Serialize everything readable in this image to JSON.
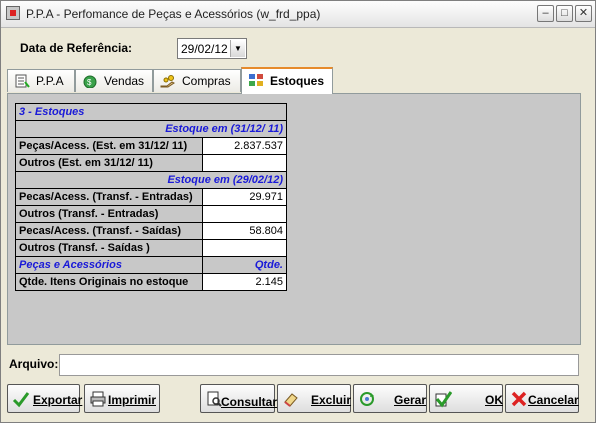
{
  "window": {
    "title": "P.P.A - Perfomance de Peças e Acessórios (w_frd_ppa)"
  },
  "reference": {
    "label": "Data de Referência:",
    "date": "29/02/12"
  },
  "tabs": [
    {
      "label": "P.P.A"
    },
    {
      "label": "Vendas"
    },
    {
      "label": "Compras"
    },
    {
      "label": "Estoques"
    }
  ],
  "stock": {
    "section_title": "3 - Estoques",
    "header1": "Estoque em (31/12/ 11)",
    "rows1": [
      {
        "label": "Peças/Acess. (Est. em 31/12/ 11)",
        "value": "2.837.537"
      },
      {
        "label": "Outros (Est. em 31/12/ 11)",
        "value": ""
      }
    ],
    "header2": "Estoque em (29/02/12)",
    "rows2": [
      {
        "label": "Pecas/Acess. (Transf. - Entradas)",
        "value": "29.971"
      },
      {
        "label": "Outros (Transf. - Entradas)",
        "value": ""
      },
      {
        "label": "Pecas/Acess. (Transf. - Saídas)",
        "value": "58.804"
      },
      {
        "label": "Outros (Transf. - Saídas )",
        "value": ""
      }
    ],
    "parts_header": "Peças e Acessórios",
    "qty_header": "Qtde.",
    "rows3": [
      {
        "label": "Qtde. Itens Originais no estoque",
        "value": "2.145"
      }
    ]
  },
  "file": {
    "label": "Arquivo:",
    "value": ""
  },
  "buttons": {
    "exportar": "Exportar",
    "imprimir": "Imprimir",
    "consultar": "Consultar",
    "excluir": "Excluir",
    "gerar": "Gerar",
    "ok": "OK",
    "cancelar": "Cancelar"
  },
  "colors": {
    "section_text": "#1a1ad8",
    "panel_bg": "#c8c8c8",
    "window_bg": "#ece9d8",
    "active_tab_accent": "#e68b2c"
  }
}
